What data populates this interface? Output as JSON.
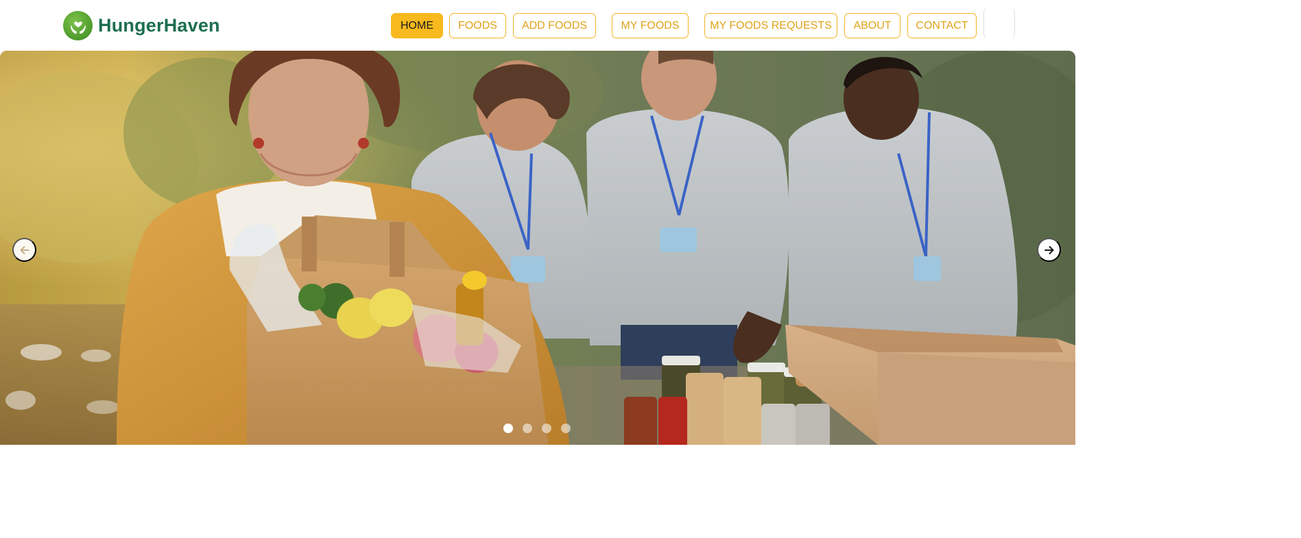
{
  "brand": {
    "name": "HungerHaven",
    "logo_icon": "hands-holding-heart-icon",
    "color": "#1c6e4e"
  },
  "nav": {
    "items": [
      {
        "label": "HOME",
        "active": true
      },
      {
        "label": "FOODS",
        "active": false
      },
      {
        "label": "ADD FOODS",
        "active": false
      },
      {
        "label": "MY FOODS",
        "active": false
      },
      {
        "label": "MY FOODS REQUESTS",
        "active": false
      },
      {
        "label": "ABOUT",
        "active": false
      },
      {
        "label": "CONTACT",
        "active": false
      }
    ],
    "accent": "#f7b91d"
  },
  "carousel": {
    "slide_image": "volunteers-food-donation-photo",
    "prev_icon": "arrow-left-icon",
    "next_icon": "arrow-right-icon",
    "slide_count": 4,
    "active_slide": 1
  }
}
